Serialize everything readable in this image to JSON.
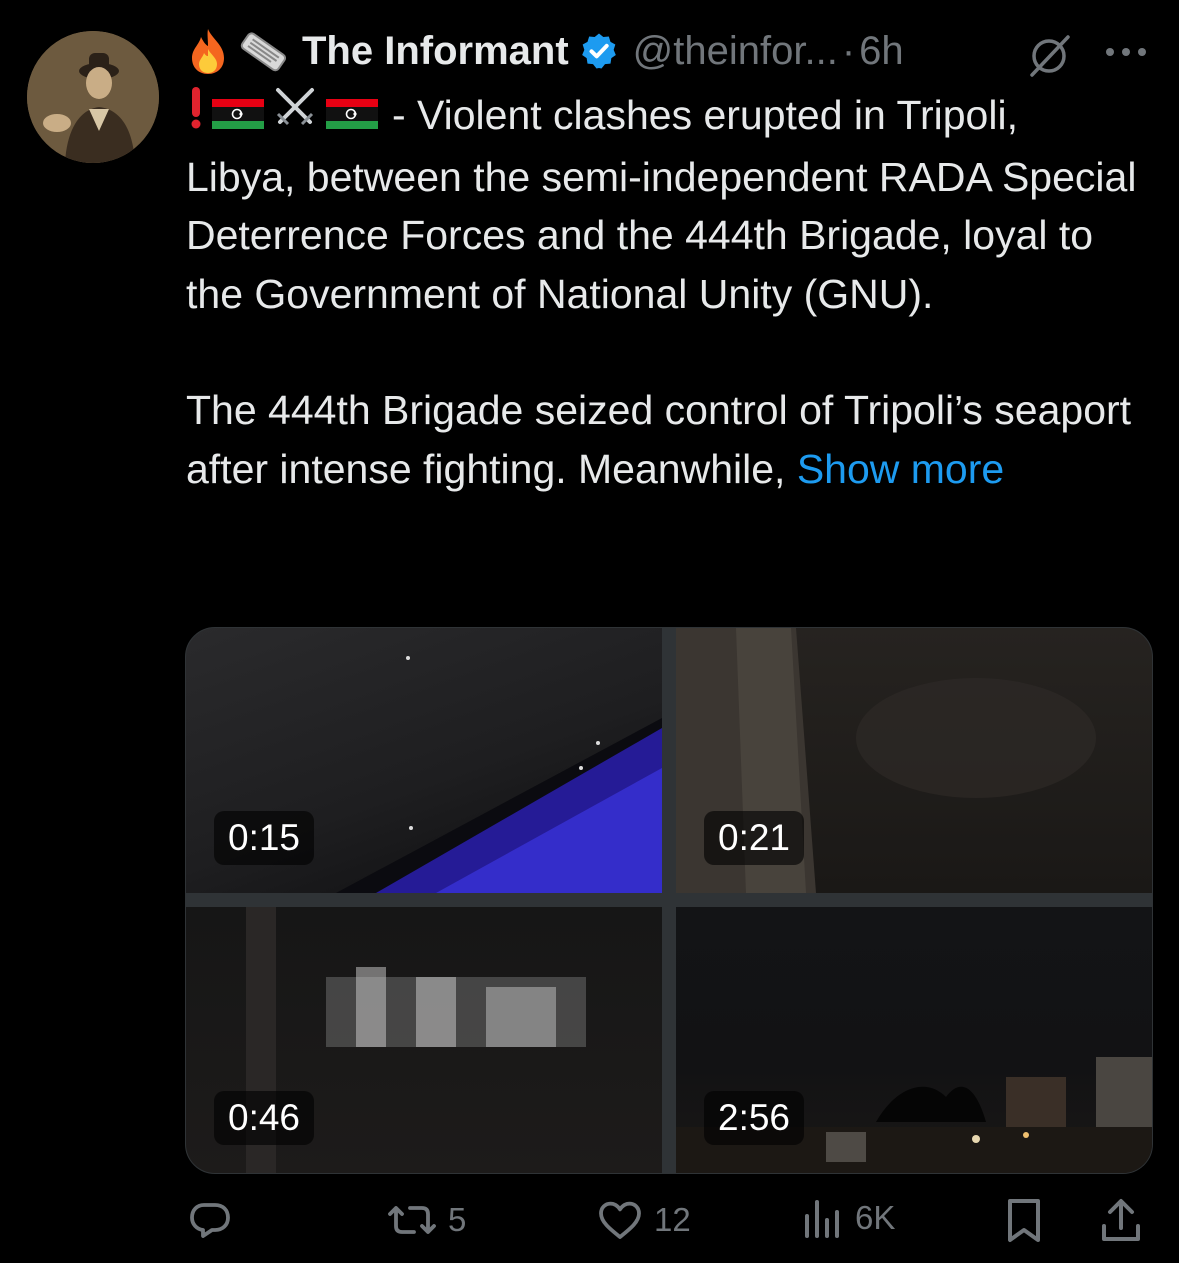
{
  "tweet": {
    "author_name": "The Informant",
    "handle": "@theinfor...",
    "separator": "·",
    "time": "6h",
    "body_line1": "- Violent clashes erupted in Tripoli,",
    "body_rest": "Libya, between the semi-independent RADA Special Deterrence Forces and the 444th Brigade, loyal to the Government of National Unity (GNU).",
    "body_para2": "The 444th Brigade seized control of Tripoli’s seaport after intense fighting. Meanwhile,",
    "show_more": "Show more"
  },
  "media": [
    {
      "duration": "0:15"
    },
    {
      "duration": "0:21"
    },
    {
      "duration": "0:46"
    },
    {
      "duration": "2:56"
    }
  ],
  "actions": {
    "retweets": "5",
    "likes": "12",
    "views": "6K"
  },
  "colors": {
    "background": "#000000",
    "text": "#e7e9ea",
    "muted": "#71767b",
    "link": "#1d9bf0",
    "verified": "#1d9bf0"
  },
  "icons": [
    "fire-icon",
    "newspaper-icon",
    "exclamation-icon",
    "libya-flag-icon",
    "crossed-swords-icon",
    "verified-badge-icon",
    "grok-icon",
    "more-icon",
    "reply-icon",
    "retweet-icon",
    "like-icon",
    "views-icon",
    "bookmark-icon",
    "share-icon"
  ]
}
